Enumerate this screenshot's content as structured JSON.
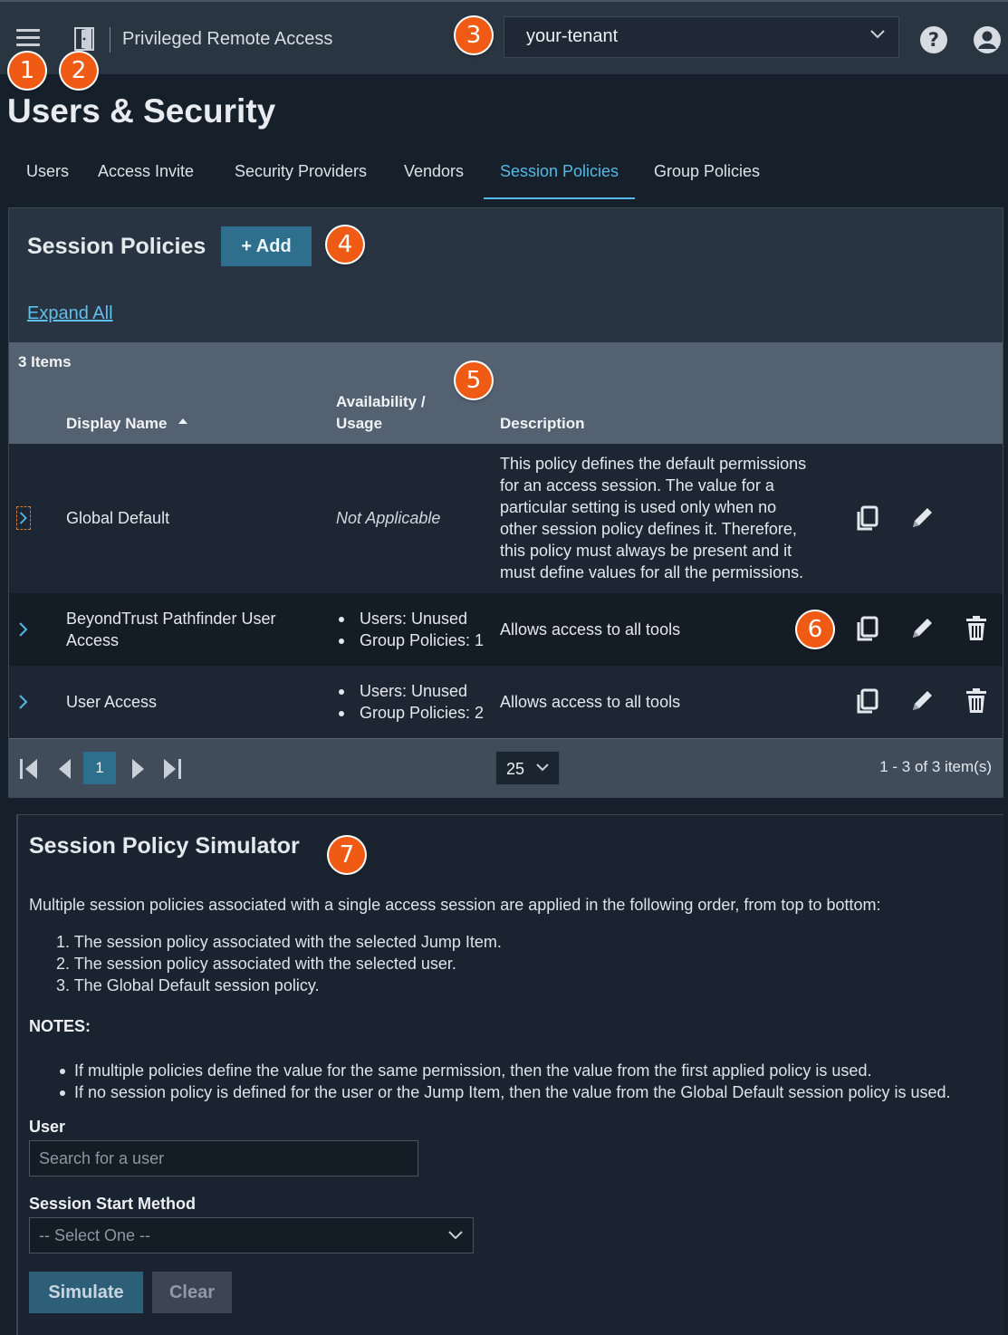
{
  "header": {
    "app_title": "Privileged Remote Access",
    "tenant": "your-tenant",
    "icons": [
      "hamburger-menu-icon",
      "door-icon",
      "chevron-down-icon",
      "help-icon",
      "user-account-icon"
    ]
  },
  "markers": [
    "1",
    "2",
    "3",
    "4",
    "5",
    "6",
    "7"
  ],
  "page_title": "Users & Security",
  "tabs": [
    {
      "label": "Users"
    },
    {
      "label": "Access Invite"
    },
    {
      "label": "Security Providers"
    },
    {
      "label": "Vendors"
    },
    {
      "label": "Session Policies",
      "active": true
    },
    {
      "label": "Group Policies"
    }
  ],
  "policies": {
    "title": "Session Policies",
    "add_label": "+ Add",
    "expand_all": "Expand All",
    "items_count": "3 Items",
    "columns": {
      "display_name": "Display Name",
      "availability_line1": "Availability /",
      "availability_line2": "Usage",
      "description": "Description"
    },
    "rows": [
      {
        "name": "Global Default",
        "availability": "Not Applicable",
        "description_lines": [
          "This policy defines the default permissions",
          "for an access session. The value for a",
          "particular setting is used only when no",
          "other session policy defines it. Therefore,",
          "this policy must always be present and it",
          "must define values for all the permissions."
        ]
      },
      {
        "name_lines": [
          "BeyondTrust Pathfinder User",
          "Access"
        ],
        "usage": [
          "Users: Unused",
          "Group Policies: 1"
        ],
        "description": "Allows access to all tools"
      },
      {
        "name": "User Access",
        "usage": [
          "Users: Unused",
          "Group Policies: 2"
        ],
        "description": "Allows access to all tools"
      }
    ],
    "pager": {
      "current_page": "1",
      "page_size": "25",
      "count_text": "1 - 3 of 3 item(s)"
    }
  },
  "simulator": {
    "title": "Session Policy Simulator",
    "intro": "Multiple session policies associated with a single access session are applied in the following order, from top to bottom:",
    "order": [
      "1. The session policy associated with the selected Jump Item.",
      "2. The session policy associated with the selected user.",
      "3. The Global Default session policy."
    ],
    "notes_label": "NOTES:",
    "notes": [
      "If multiple policies define the value for the same permission, then the value from the first applied policy is used.",
      "If no session policy is defined for the user or the Jump Item, then the value from the Global Default session policy is used."
    ],
    "user_label": "User",
    "user_placeholder": "Search for a user",
    "method_label": "Session Start Method",
    "method_value": "-- Select One --",
    "simulate_label": "Simulate",
    "clear_label": "Clear"
  },
  "colors": {
    "accent": "#56b8e6",
    "button": "#2e6f8e",
    "marker": "#ef5a14"
  }
}
